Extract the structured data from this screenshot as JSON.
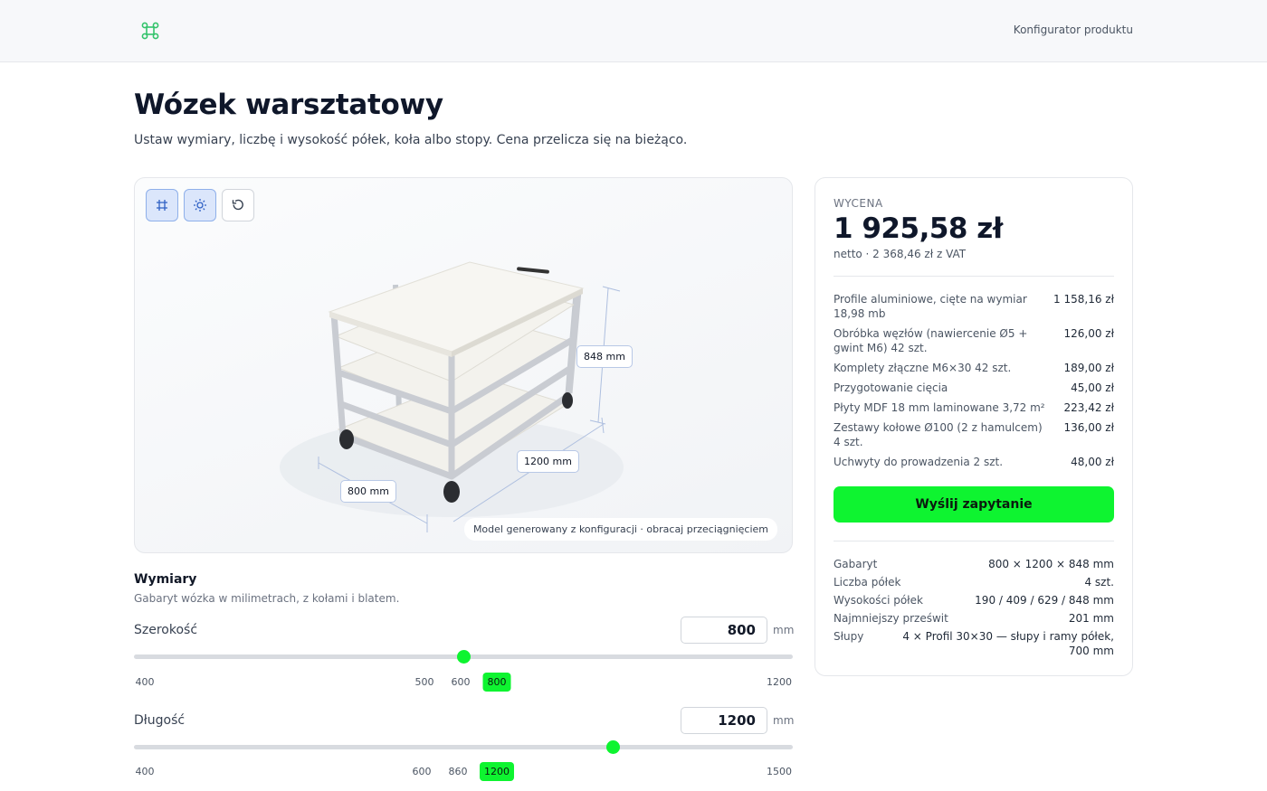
{
  "header": {
    "logo_icon": "command-icon",
    "nav_link": "Konfigurator produktu"
  },
  "page": {
    "title": "Wózek warsztatowy",
    "subtitle": "Ustaw wymiary, liczbę i wysokość półek, koła albo stopy. Cena przelicza się na bieżąco."
  },
  "viewer": {
    "tools": [
      {
        "icon": "dimensions-icon",
        "active": true
      },
      {
        "icon": "sun-icon",
        "active": true
      },
      {
        "icon": "reset-view-icon",
        "active": false
      }
    ],
    "dim_height": "848 mm",
    "dim_length": "1200 mm",
    "dim_width": "800 mm",
    "note": "Model generowany z konfiguracji · obracaj przeciągnięciem"
  },
  "quote": {
    "eyebrow": "WYCENA",
    "price": "1 925,58 zł",
    "net": "netto · 2 368,46 zł z VAT",
    "lines": [
      {
        "desc": "Profile aluminiowe, cięte na wymiar 18,98 mb",
        "amount": "1 158,16 zł"
      },
      {
        "desc": "Obróbka węzłów (nawiercenie Ø5 + gwint M6) 42 szt.",
        "amount": "126,00 zł"
      },
      {
        "desc": "Komplety złączne M6×30 42 szt.",
        "amount": "189,00 zł"
      },
      {
        "desc": "Przygotowanie cięcia",
        "amount": "45,00 zł"
      },
      {
        "desc": "Płyty MDF 18 mm laminowane 3,72 m²",
        "amount": "223,42 zł"
      },
      {
        "desc": "Zestawy kołowe Ø100 (2 z hamulcem) 4 szt.",
        "amount": "136,00 zł"
      },
      {
        "desc": "Uchwyty do prowadzenia 2 szt.",
        "amount": "48,00 zł"
      }
    ],
    "cta": "Wyślij zapytanie",
    "specs": [
      {
        "k": "Gabaryt",
        "v": "800 × 1200 × 848 mm"
      },
      {
        "k": "Liczba półek",
        "v": "4 szt."
      },
      {
        "k": "Wysokości półek",
        "v": "190 / 409 / 629 / 848 mm"
      },
      {
        "k": "Najmniejszy prześwit",
        "v": "201 mm"
      },
      {
        "k": "Słupy",
        "v": "4 × Profil 30×30 — słupy i ramy półek, 700 mm"
      }
    ]
  },
  "dimensions": {
    "title": "Wymiary",
    "subtitle": "Gabaryt wózka w milimetrach, z kołami i blatem.",
    "fields": [
      {
        "label": "Szerokość",
        "value": "800",
        "unit": "mm",
        "min": 400,
        "max": 1200,
        "current": 800,
        "ticks": [
          "400",
          "500",
          "600",
          "800",
          "1200"
        ],
        "active_tick": "800"
      },
      {
        "label": "Długość",
        "value": "1200",
        "unit": "mm",
        "min": 400,
        "max": 1500,
        "current": 1200,
        "ticks": [
          "400",
          "600",
          "860",
          "1200",
          "1500"
        ],
        "active_tick": "1200"
      }
    ]
  },
  "colors": {
    "accent": "#0ef430",
    "tool_active_bg": "#dbe6fb"
  }
}
